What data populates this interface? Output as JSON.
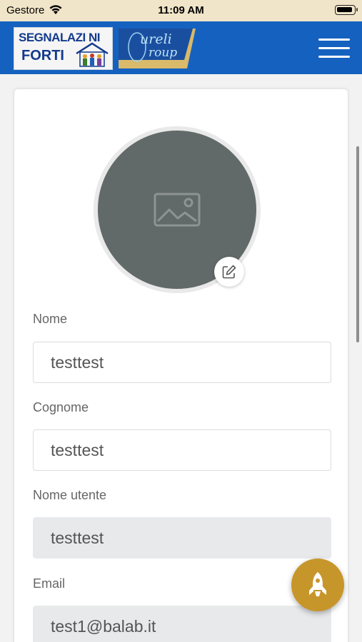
{
  "status_bar": {
    "carrier": "Gestore",
    "time": "11:09 AM",
    "wifi_icon": "wifi-icon",
    "battery_icon": "battery-icon"
  },
  "header": {
    "logo_main": {
      "line1": "SEGNALAZI  NI",
      "line2": "FORTI"
    },
    "logo_partner": {
      "line1": "ureli",
      "line2": "roup"
    },
    "menu_icon": "hamburger-menu-icon",
    "color": "#1561bf"
  },
  "profile": {
    "avatar_icon": "image-placeholder-icon",
    "edit_icon": "edit-icon",
    "fields": [
      {
        "label": "Nome",
        "value": "testtest",
        "readonly": false
      },
      {
        "label": "Cognome",
        "value": "testtest",
        "readonly": false
      },
      {
        "label": "Nome utente",
        "value": "testtest",
        "readonly": true
      },
      {
        "label": "Email",
        "value": "test1@balab.it",
        "readonly": true
      }
    ]
  },
  "fab": {
    "icon": "rocket-icon",
    "color": "#c7962a"
  }
}
